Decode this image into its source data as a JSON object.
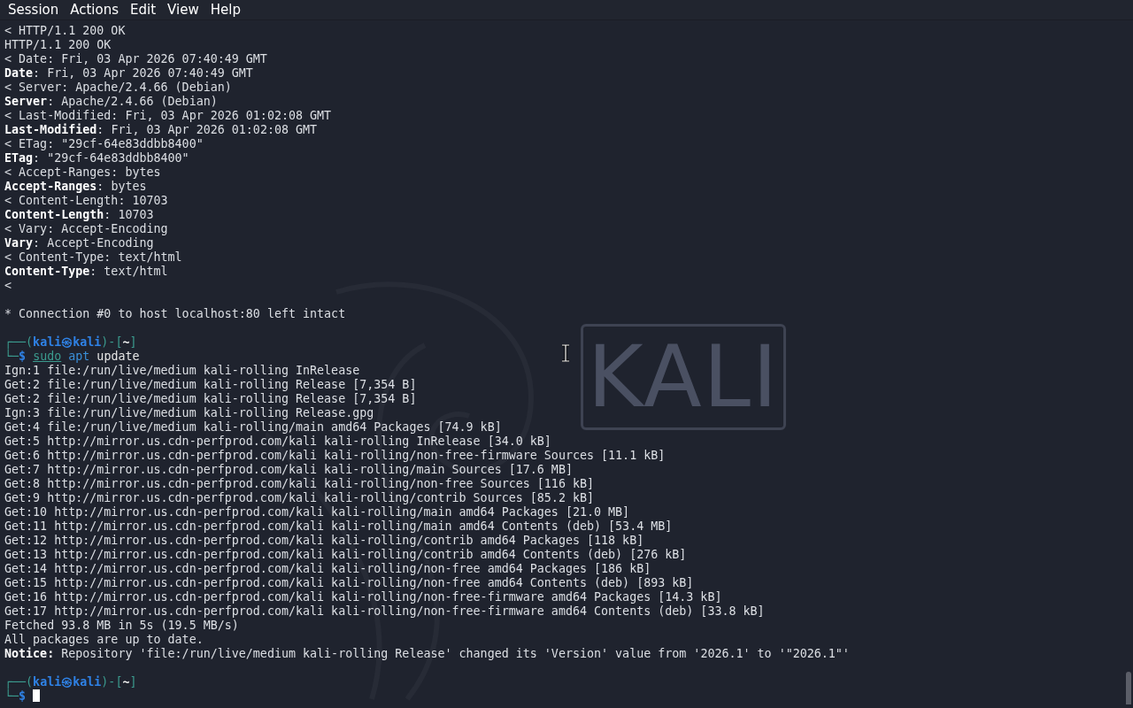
{
  "menu_bar": [
    {
      "label": "Session"
    },
    {
      "label": "Actions"
    },
    {
      "label": "Edit"
    },
    {
      "label": "View"
    },
    {
      "label": "Help"
    }
  ],
  "wallpaper": {
    "logo": "KALI"
  },
  "terminal_lines": [
    {
      "kind": "text",
      "text": "< HTTP/1.1 200 OK"
    },
    {
      "kind": "text",
      "text": "HTTP/1.1 200 OK"
    },
    {
      "kind": "text",
      "text": "< Date: Fri, 03 Apr 2026 07:40:49 GMT"
    },
    {
      "kind": "text",
      "text": "**Date**: Fri, 03 Apr 2026 07:40:49 GMT"
    },
    {
      "kind": "text",
      "text": "< Server: Apache/2.4.66 (Debian)"
    },
    {
      "kind": "text",
      "text": "**Server**: Apache/2.4.66 (Debian)"
    },
    {
      "kind": "text",
      "text": "< Last-Modified: Fri, 03 Apr 2026 01:02:08 GMT"
    },
    {
      "kind": "text",
      "text": "**Last-Modified**: Fri, 03 Apr 2026 01:02:08 GMT"
    },
    {
      "kind": "text",
      "text": "< ETag: \"29cf-64e83ddbb8400\""
    },
    {
      "kind": "text",
      "text": "**ETag**: \"29cf-64e83ddbb8400\""
    },
    {
      "kind": "text",
      "text": "< Accept-Ranges: bytes"
    },
    {
      "kind": "text",
      "text": "**Accept-Ranges**: bytes"
    },
    {
      "kind": "text",
      "text": "< Content-Length: 10703"
    },
    {
      "kind": "text",
      "text": "**Content-Length**: 10703"
    },
    {
      "kind": "text",
      "text": "< Vary: Accept-Encoding"
    },
    {
      "kind": "text",
      "text": "**Vary**: Accept-Encoding"
    },
    {
      "kind": "text",
      "text": "< Content-Type: text/html"
    },
    {
      "kind": "text",
      "text": "**Content-Type**: text/html"
    },
    {
      "kind": "text",
      "text": "<"
    },
    {
      "kind": "blank"
    },
    {
      "kind": "text",
      "text": "* Connection #0 to host localhost:80 left intact"
    },
    {
      "kind": "blank"
    },
    {
      "kind": "prompt",
      "segments": [
        {
          "kind": "frame",
          "text": "┌──("
        },
        {
          "kind": "user",
          "text": "kali"
        },
        {
          "kind": "user",
          "text": "㉿"
        },
        {
          "kind": "user",
          "text": "kali"
        },
        {
          "kind": "frame",
          "text": ")-["
        },
        {
          "kind": "dir",
          "text": "~"
        },
        {
          "kind": "frame",
          "text": "]"
        }
      ]
    },
    {
      "kind": "prompt",
      "segments": [
        {
          "kind": "frame",
          "text": "└─"
        },
        {
          "kind": "user",
          "text": "$ "
        },
        {
          "kind": "sudo",
          "text": "sudo"
        },
        {
          "kind": "cmd",
          "text": " apt"
        },
        {
          "kind": "arg",
          "text": " update"
        }
      ]
    },
    {
      "kind": "text",
      "text": "Ign:1 file:/run/live/medium kali-rolling InRelease"
    },
    {
      "kind": "text",
      "text": "Get:2 file:/run/live/medium kali-rolling Release [7,354 B]"
    },
    {
      "kind": "text",
      "text": "Get:2 file:/run/live/medium kali-rolling Release [7,354 B]"
    },
    {
      "kind": "text",
      "text": "Ign:3 file:/run/live/medium kali-rolling Release.gpg"
    },
    {
      "kind": "text",
      "text": "Get:4 file:/run/live/medium kali-rolling/main amd64 Packages [74.9 kB]"
    },
    {
      "kind": "text",
      "text": "Get:5 http://mirror.us.cdn-perfprod.com/kali kali-rolling InRelease [34.0 kB]"
    },
    {
      "kind": "text",
      "text": "Get:6 http://mirror.us.cdn-perfprod.com/kali kali-rolling/non-free-firmware Sources [11.1 kB]"
    },
    {
      "kind": "text",
      "text": "Get:7 http://mirror.us.cdn-perfprod.com/kali kali-rolling/main Sources [17.6 MB]"
    },
    {
      "kind": "text",
      "text": "Get:8 http://mirror.us.cdn-perfprod.com/kali kali-rolling/non-free Sources [116 kB]"
    },
    {
      "kind": "text",
      "text": "Get:9 http://mirror.us.cdn-perfprod.com/kali kali-rolling/contrib Sources [85.2 kB]"
    },
    {
      "kind": "text",
      "text": "Get:10 http://mirror.us.cdn-perfprod.com/kali kali-rolling/main amd64 Packages [21.0 MB]"
    },
    {
      "kind": "text",
      "text": "Get:11 http://mirror.us.cdn-perfprod.com/kali kali-rolling/main amd64 Contents (deb) [53.4 MB]"
    },
    {
      "kind": "text",
      "text": "Get:12 http://mirror.us.cdn-perfprod.com/kali kali-rolling/contrib amd64 Packages [118 kB]"
    },
    {
      "kind": "text",
      "text": "Get:13 http://mirror.us.cdn-perfprod.com/kali kali-rolling/contrib amd64 Contents (deb) [276 kB]"
    },
    {
      "kind": "text",
      "text": "Get:14 http://mirror.us.cdn-perfprod.com/kali kali-rolling/non-free amd64 Packages [186 kB]"
    },
    {
      "kind": "text",
      "text": "Get:15 http://mirror.us.cdn-perfprod.com/kali kali-rolling/non-free amd64 Contents (deb) [893 kB]"
    },
    {
      "kind": "text",
      "text": "Get:16 http://mirror.us.cdn-perfprod.com/kali kali-rolling/non-free-firmware amd64 Packages [14.3 kB]"
    },
    {
      "kind": "text",
      "text": "Get:17 http://mirror.us.cdn-perfprod.com/kali kali-rolling/non-free-firmware amd64 Contents (deb) [33.8 kB]"
    },
    {
      "kind": "text",
      "text": "Fetched 93.8 MB in 5s (19.5 MB/s)"
    },
    {
      "kind": "text",
      "text": "All packages are up to date."
    },
    {
      "kind": "text",
      "text": "**Notice:** Repository 'file:/run/live/medium kali-rolling Release' changed its 'Version' value from '2026.1' to '\"2026.1\"'"
    },
    {
      "kind": "blank"
    },
    {
      "kind": "prompt",
      "segments": [
        {
          "kind": "frame",
          "text": "┌──("
        },
        {
          "kind": "user",
          "text": "kali"
        },
        {
          "kind": "user",
          "text": "㉿"
        },
        {
          "kind": "user",
          "text": "kali"
        },
        {
          "kind": "frame",
          "text": ")-["
        },
        {
          "kind": "dir",
          "text": "~"
        },
        {
          "kind": "frame",
          "text": "]"
        }
      ]
    },
    {
      "kind": "prompt",
      "segments": [
        {
          "kind": "frame",
          "text": "└─"
        },
        {
          "kind": "user",
          "text": "$ "
        },
        {
          "kind": "cursor"
        }
      ]
    }
  ]
}
